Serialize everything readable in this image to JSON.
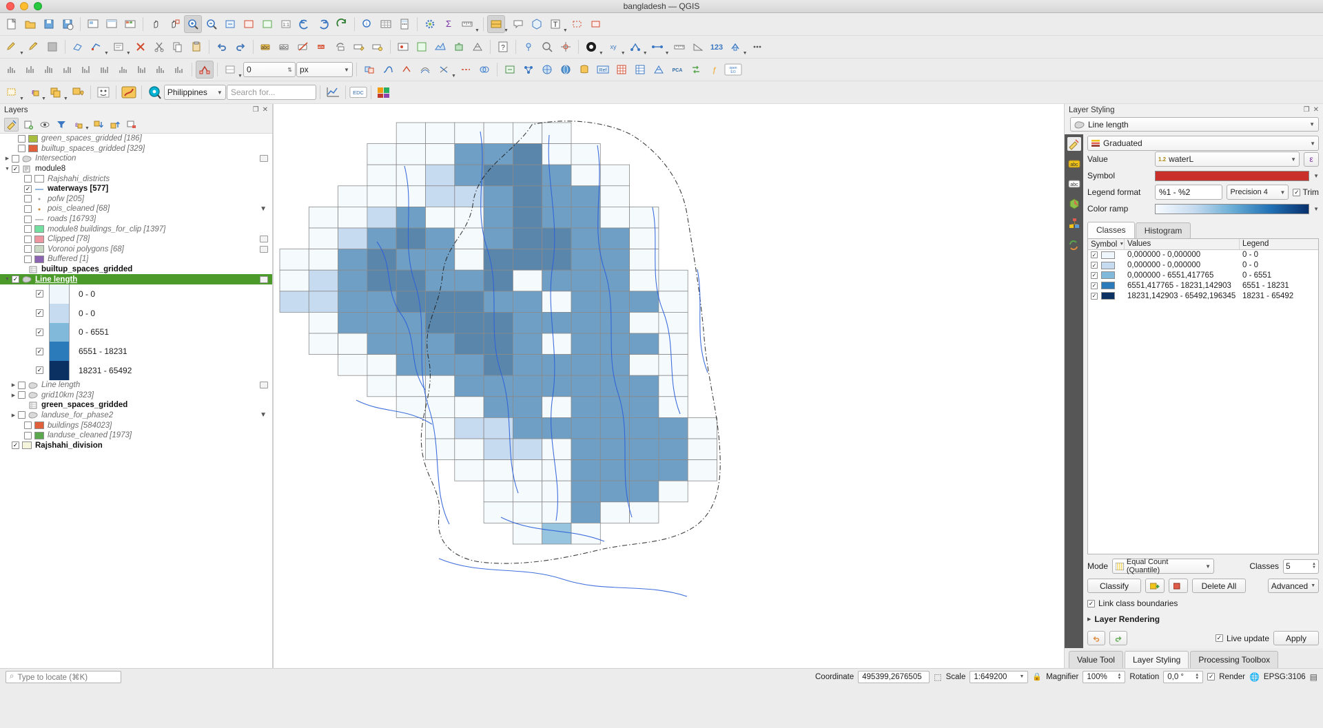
{
  "window": {
    "title": "bangladesh — QGIS"
  },
  "toolbars": {
    "row1": [
      "new-project",
      "open-project",
      "save-project",
      "save-project-as",
      "print-layout",
      "style-manager",
      "pan-map",
      "pan-to-selection",
      "zoom-in",
      "zoom-out",
      "zoom-full",
      "zoom-selection",
      "zoom-layer",
      "zoom-native",
      "zoom-last",
      "zoom-next",
      "refresh",
      "identify-features",
      "open-attribute-table",
      "field-calculator",
      "processing-toolbox",
      "statistical-summary",
      "measure-line",
      "new-map-view",
      "show-map-tips",
      "new-3d-map-view",
      "text-annotation",
      "deselect-features",
      "select-features"
    ],
    "row2": [
      "current-edits",
      "toggle-editing",
      "save-layer-edits",
      "add-feature",
      "vertex-tool",
      "modify-attributes",
      "delete-selected",
      "cut-features",
      "copy-features",
      "paste-features",
      "undo",
      "redo",
      "label-toolbar",
      "pin-labels",
      "show-hide-labels",
      "move-label",
      "rotate-label",
      "change-label",
      "highlight-pinned",
      "georeferencer",
      "raster-calculator",
      "terrain-profile",
      "plugins",
      "help",
      "gps-information",
      "metasearch",
      "coordinate-capture",
      "point-symbol",
      "xy-tool",
      "topology",
      "node-tool",
      "measure-bearing",
      "numeric-123",
      "snapping-options"
    ],
    "row3": [
      "histogram",
      "mesh-tools",
      "raster-tools",
      "zonal-stats",
      "snapping-enabled",
      "avoid-overlap",
      "snap-tolerance",
      "tolerance-value",
      "tolerance-units",
      "enable-tracing",
      "trace-settings",
      "offset-curve",
      "reshape",
      "split-features",
      "merge-features",
      "geoprocessing",
      "network-analysis",
      "openstreetmap",
      "globe",
      "db-manager",
      "ref-layer",
      "grid-tool",
      "table-tool",
      "mesh-layer",
      "pca-tool",
      "transform",
      "expression",
      "openeo-plugin"
    ],
    "row4": [
      "select-by-area",
      "select-by-value",
      "select-by-expression",
      "select-all",
      "invert-selection",
      "deselect-all",
      "country-picker",
      "search-box",
      "plot-tool",
      "edc-plugin",
      "qgis-plugin"
    ],
    "tolerance_value": "0",
    "tolerance_units": "px",
    "country_value": "Philippines",
    "search_placeholder": "Search for...",
    "edc_label": "EDC",
    "num_label": "123"
  },
  "layers_panel": {
    "title": "Layers",
    "toolbar": [
      "open-layer-styling-panel",
      "add-group",
      "manage-layer-visibility",
      "filter-legend",
      "expression-filter",
      "expand-all",
      "collapse-all",
      "remove-layer"
    ],
    "items": [
      {
        "name": "green_spaces_gridded [186]",
        "checked": false,
        "style": "italic",
        "indent": 1,
        "swatch": "#a7bd3e",
        "swatch_type": "fill",
        "expander": ""
      },
      {
        "name": "builtup_spaces_gridded [329]",
        "checked": false,
        "style": "italic",
        "indent": 1,
        "swatch": "#e0603c",
        "swatch_type": "fill",
        "expander": ""
      },
      {
        "name": "Intersection",
        "checked": false,
        "style": "italic",
        "indent": 0,
        "swatch": "#d9d9d9",
        "swatch_type": "poly",
        "expander": "right",
        "badge": true
      },
      {
        "name": "module8",
        "checked": true,
        "style": "normal",
        "indent": 0,
        "swatch": "#cfcfcf",
        "swatch_type": "group",
        "expander": "down"
      },
      {
        "name": "Rajshahi_districts",
        "checked": false,
        "style": "italic",
        "indent": 2,
        "swatch": "#ffffff",
        "swatch_type": "fill",
        "expander": ""
      },
      {
        "name": "waterways [577]",
        "checked": true,
        "style": "bold",
        "indent": 2,
        "swatch": "#7aa5d8",
        "swatch_type": "line",
        "expander": ""
      },
      {
        "name": "pofw [205]",
        "checked": false,
        "style": "italic",
        "indent": 2,
        "swatch": "#9b9b9b",
        "swatch_type": "dot",
        "expander": ""
      },
      {
        "name": "pois_cleaned [68]",
        "checked": false,
        "style": "italic",
        "indent": 2,
        "swatch": "#c8862d",
        "swatch_type": "dot",
        "expander": "",
        "badge_filter": true
      },
      {
        "name": "roads [16793]",
        "checked": false,
        "style": "italic",
        "indent": 2,
        "swatch": "#b4b4b4",
        "swatch_type": "line",
        "expander": ""
      },
      {
        "name": "module8 buildings_for_clip [1397]",
        "checked": false,
        "style": "italic",
        "indent": 2,
        "swatch": "#72dfa0",
        "swatch_type": "fill",
        "expander": ""
      },
      {
        "name": "Clipped [78]",
        "checked": false,
        "style": "italic",
        "indent": 2,
        "swatch": "#ed96a2",
        "swatch_type": "fill",
        "expander": "",
        "badge": true
      },
      {
        "name": "Voronoi polygons [68]",
        "checked": false,
        "style": "italic",
        "indent": 2,
        "swatch": "#c9d8c2",
        "swatch_type": "fill",
        "expander": "",
        "badge": true
      },
      {
        "name": "Buffered [1]",
        "checked": false,
        "style": "italic",
        "indent": 2,
        "swatch": "#8c64b2",
        "swatch_type": "fill",
        "expander": ""
      },
      {
        "name": "builtup_spaces_gridded",
        "checked": null,
        "style": "bold",
        "indent": 1,
        "swatch": "#e9e9e9",
        "swatch_type": "table",
        "expander": ""
      },
      {
        "name": "Line length",
        "checked": true,
        "style": "bold-selected",
        "indent": 0,
        "swatch": "#cfcfcf",
        "swatch_type": "poly",
        "expander": "down",
        "badge": true
      }
    ],
    "classes": [
      {
        "label": "0 - 0",
        "color": "#eff6fc",
        "checked": true
      },
      {
        "label": "0 - 0",
        "color": "#c6dbef",
        "checked": true
      },
      {
        "label": "0 - 6551",
        "color": "#80b9da",
        "checked": true
      },
      {
        "label": "6551 - 18231",
        "color": "#2b7bba",
        "checked": true
      },
      {
        "label": "18231 - 65492",
        "color": "#0b3163",
        "checked": true
      }
    ],
    "items_after": [
      {
        "name": "Line length",
        "checked": false,
        "style": "italic",
        "indent": 1,
        "swatch": "#d9d9d9",
        "swatch_type": "poly",
        "expander": "right",
        "badge": true
      },
      {
        "name": "grid10km [323]",
        "checked": false,
        "style": "italic",
        "indent": 1,
        "swatch": "#d9d9d9",
        "swatch_type": "poly",
        "expander": "right"
      },
      {
        "name": "green_spaces_gridded",
        "checked": null,
        "style": "bold",
        "indent": 1,
        "swatch": "#e9e9e9",
        "swatch_type": "table",
        "expander": ""
      },
      {
        "name": "landuse_for_phase2",
        "checked": false,
        "style": "italic",
        "indent": 1,
        "swatch": "#d9d9d9",
        "swatch_type": "poly",
        "expander": "right",
        "badge_filter": true
      },
      {
        "name": "buildings [584023]",
        "checked": false,
        "style": "italic",
        "indent": 2,
        "swatch": "#e0603c",
        "swatch_type": "fill",
        "expander": ""
      },
      {
        "name": "landuse_cleaned [1973]",
        "checked": false,
        "style": "italic",
        "indent": 2,
        "swatch": "#5aa74e",
        "swatch_type": "fill",
        "expander": ""
      },
      {
        "name": "Rajshahi_division",
        "checked": true,
        "style": "bold",
        "indent": 0,
        "swatch": "#f5f5dc",
        "swatch_type": "fill",
        "expander": ""
      }
    ]
  },
  "styling_panel": {
    "title": "Layer Styling",
    "layer_name": "Line length",
    "renderer": "Graduated",
    "labels": {
      "value": "Value",
      "symbol": "Symbol",
      "legend_format": "Legend format",
      "color_ramp": "Color ramp",
      "mode": "Mode",
      "classes": "Classes",
      "link_class_boundaries": "Link class boundaries",
      "layer_rendering": "Layer Rendering",
      "live_update": "Live update",
      "trim": "Trim"
    },
    "value_field": "waterL",
    "value_prefix": "1.2",
    "symbol_color": "#c9302c",
    "legend_format": "%1 - %2",
    "precision": "Precision 4",
    "trim_checked": true,
    "tabs": [
      {
        "label": "Classes",
        "active": true
      },
      {
        "label": "Histogram",
        "active": false
      }
    ],
    "table_headers": [
      "Symbol",
      "Values",
      "Legend"
    ],
    "rows": [
      {
        "color": "#eff6fc",
        "values": "0,000000 - 0,000000",
        "legend": "0 - 0",
        "checked": true
      },
      {
        "color": "#c6dbef",
        "values": "0,000000 - 0,000000",
        "legend": "0 - 0",
        "checked": true
      },
      {
        "color": "#80b9da",
        "values": "0,000000 - 6551,417765",
        "legend": "0 - 6551",
        "checked": true
      },
      {
        "color": "#2b7bba",
        "values": "6551,417765 - 18231,142903",
        "legend": "6551 - 18231",
        "checked": true
      },
      {
        "color": "#0b3163",
        "values": "18231,142903 - 65492,196345",
        "legend": "18231 - 65492",
        "checked": true
      }
    ],
    "mode_value": "Equal Count (Quantile)",
    "classes_count": "5",
    "buttons": {
      "classify": "Classify",
      "add": "+",
      "remove": "−",
      "delete_all": "Delete All",
      "advanced": "Advanced",
      "apply": "Apply"
    },
    "link_checked": true,
    "live_update_checked": true,
    "bottom_tabs": [
      {
        "label": "Value Tool",
        "active": false
      },
      {
        "label": "Layer Styling",
        "active": true
      },
      {
        "label": "Processing Toolbox",
        "active": false
      }
    ]
  },
  "statusbar": {
    "locator_placeholder": "Type to locate (⌘K)",
    "coordinate_label": "Coordinate",
    "coordinate_value": "495399,2676505",
    "scale_label": "Scale",
    "scale_value": "1:649200",
    "magnifier_label": "Magnifier",
    "magnifier_value": "100%",
    "rotation_label": "Rotation",
    "rotation_value": "0,0 °",
    "render_label": "Render",
    "render_checked": true,
    "crs_label": "EPSG:3106"
  },
  "map": {
    "grid_cols": 16,
    "grid_rows": 20,
    "colors": {
      "c0": "#f5fafd",
      "c1": "#c6dbef",
      "c2": "#97c5e0",
      "c3": "#6f9fc4",
      "c4": "#5b86ab",
      "empty": "#ffffff",
      "grid_line": "#8a8a8a",
      "boundary": "#1b1b1b",
      "river": "#2b5fd9"
    },
    "cells": [
      [
        -1,
        -1,
        -1,
        -1,
        0,
        0,
        0,
        0,
        0,
        0,
        -1,
        -1,
        -1,
        -1,
        -1,
        -1
      ],
      [
        -1,
        -1,
        -1,
        0,
        0,
        0,
        3,
        3,
        4,
        0,
        0,
        -1,
        -1,
        -1,
        -1,
        -1
      ],
      [
        -1,
        -1,
        -1,
        0,
        0,
        1,
        3,
        4,
        4,
        3,
        0,
        0,
        -1,
        -1,
        -1,
        -1
      ],
      [
        -1,
        -1,
        0,
        0,
        0,
        1,
        1,
        3,
        4,
        3,
        3,
        0,
        -1,
        -1,
        -1,
        -1
      ],
      [
        -1,
        0,
        0,
        1,
        3,
        0,
        0,
        3,
        4,
        3,
        3,
        0,
        0,
        -1,
        -1,
        -1
      ],
      [
        -1,
        0,
        1,
        3,
        4,
        3,
        0,
        3,
        4,
        4,
        3,
        3,
        0,
        -1,
        -1,
        -1
      ],
      [
        0,
        0,
        3,
        4,
        3,
        3,
        0,
        4,
        4,
        4,
        3,
        3,
        0,
        -1,
        -1,
        -1
      ],
      [
        0,
        1,
        3,
        4,
        4,
        3,
        3,
        4,
        0,
        3,
        3,
        3,
        0,
        0,
        -1,
        -1
      ],
      [
        1,
        1,
        3,
        3,
        4,
        4,
        4,
        3,
        3,
        0,
        3,
        3,
        3,
        0,
        -1,
        -1
      ],
      [
        -1,
        0,
        3,
        3,
        3,
        4,
        4,
        4,
        3,
        3,
        3,
        3,
        0,
        0,
        -1,
        -1
      ],
      [
        -1,
        0,
        0,
        3,
        3,
        3,
        4,
        4,
        3,
        0,
        3,
        3,
        3,
        0,
        -1,
        -1
      ],
      [
        -1,
        -1,
        0,
        0,
        3,
        3,
        3,
        4,
        3,
        3,
        3,
        3,
        0,
        0,
        -1,
        -1
      ],
      [
        -1,
        -1,
        -1,
        0,
        0,
        0,
        3,
        3,
        3,
        3,
        3,
        3,
        3,
        0,
        -1,
        -1
      ],
      [
        -1,
        -1,
        -1,
        -1,
        0,
        0,
        0,
        3,
        3,
        0,
        3,
        3,
        3,
        0,
        -1,
        -1
      ],
      [
        -1,
        -1,
        -1,
        -1,
        -1,
        0,
        1,
        1,
        3,
        3,
        3,
        3,
        3,
        3,
        0,
        -1
      ],
      [
        -1,
        -1,
        -1,
        -1,
        -1,
        0,
        0,
        1,
        1,
        0,
        3,
        3,
        3,
        3,
        0,
        -1
      ],
      [
        -1,
        -1,
        -1,
        -1,
        -1,
        -1,
        0,
        0,
        0,
        0,
        3,
        3,
        3,
        3,
        0,
        -1
      ],
      [
        -1,
        -1,
        -1,
        -1,
        -1,
        -1,
        -1,
        0,
        0,
        0,
        3,
        3,
        3,
        0,
        -1,
        -1
      ],
      [
        -1,
        -1,
        -1,
        -1,
        -1,
        -1,
        -1,
        0,
        0,
        0,
        3,
        0,
        0,
        -1,
        -1,
        -1
      ],
      [
        -1,
        -1,
        -1,
        -1,
        -1,
        -1,
        -1,
        -1,
        0,
        2,
        0,
        -1,
        -1,
        -1,
        -1,
        -1
      ]
    ]
  }
}
